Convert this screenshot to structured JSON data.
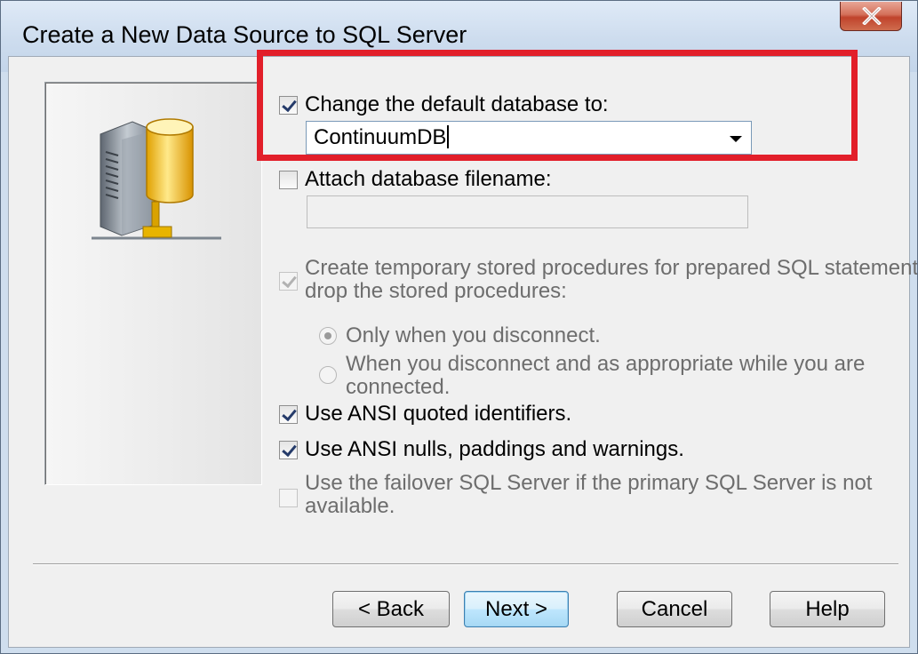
{
  "window": {
    "title": "Create a New Data Source to SQL Server"
  },
  "icons": {
    "close": "close-x-icon",
    "server": "database-server-icon",
    "combo_arrow": "chevron-down-icon"
  },
  "colors": {
    "highlight": "#e21f2a",
    "close_button": "#c0432c",
    "default_button_border": "#3c7fb1"
  },
  "options": {
    "change_db": {
      "label": "Change the default database to:",
      "checked": true,
      "enabled": true
    },
    "default_db_value": "ContinuumDB",
    "attach_db": {
      "label": "Attach database filename:",
      "checked": false,
      "enabled": true
    },
    "attach_db_value": "",
    "temp_procs": {
      "line1": "Create temporary stored procedures for prepared SQL statements and",
      "line2": "drop the stored procedures:",
      "checked": true,
      "enabled": false
    },
    "radio_disconnect": {
      "label": "Only when you disconnect.",
      "selected": true,
      "enabled": false
    },
    "radio_appropriate": {
      "line1": "When you disconnect and as appropriate while you are",
      "line2": "connected.",
      "selected": false,
      "enabled": false
    },
    "ansi_quoted": {
      "label": "Use ANSI quoted identifiers.",
      "checked": true,
      "enabled": true
    },
    "ansi_nulls": {
      "label": "Use ANSI nulls, paddings and warnings.",
      "checked": true,
      "enabled": true
    },
    "failover": {
      "line1": "Use the failover SQL Server if the primary SQL Server is not",
      "line2": "available.",
      "checked": false,
      "enabled": false
    }
  },
  "buttons": {
    "back": "< Back",
    "next": "Next >",
    "cancel": "Cancel",
    "help": "Help"
  }
}
